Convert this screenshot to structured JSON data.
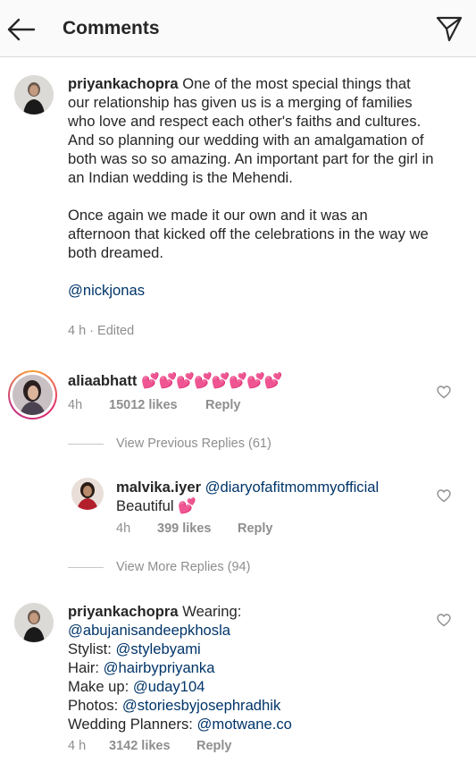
{
  "header": {
    "title": "Comments"
  },
  "caption": {
    "username": "priyankachopra",
    "paragraphs": [
      "One of the most special things that our relationship has given us is a merging of families who love and respect each other's faiths and cultures. And so planning our wedding with an amalgamation of both was so so amazing. An important part for the girl in an Indian wedding is the Mehendi.",
      "Once again we made it our own and it was an afternoon that kicked off the celebrations in the way we both dreamed."
    ],
    "mention": "@nickjonas",
    "meta": "4 h · Edited"
  },
  "comment1": {
    "username": "aliaabhatt",
    "emoji": "💕💕💕💕💕💕💕💕",
    "time": "4h",
    "likes": "15012 likes",
    "reply": "Reply"
  },
  "view_previous": "View Previous Replies (61)",
  "reply1": {
    "username": "malvika.iyer",
    "mention": "@diaryofafitmommyofficial",
    "text": "Beautiful",
    "emoji": "💕",
    "time": "4h",
    "likes": "399 likes",
    "reply": "Reply"
  },
  "view_more": "View More Replies (94)",
  "comment2": {
    "username": "priyankachopra",
    "wearing_label": "Wearing:",
    "wearing_mention": "@abujanisandeepkhosla",
    "stylist_label": "Stylist:",
    "stylist_mention": "@stylebyami",
    "hair_label": "Hair:",
    "hair_mention": "@hairbypriyanka",
    "makeup_label": "Make up:",
    "makeup_mention": "@uday104",
    "photos_label": "Photos:",
    "photos_mention": "@storiesbyjosephradhik",
    "planners_label": "Wedding Planners:",
    "planners_mention": "@motwane.co",
    "time": "4 h",
    "likes": "3142 likes",
    "reply": "Reply"
  },
  "icons": {
    "back": "arrow-left-icon",
    "send": "paper-plane-icon",
    "like": "heart-outline-icon"
  }
}
